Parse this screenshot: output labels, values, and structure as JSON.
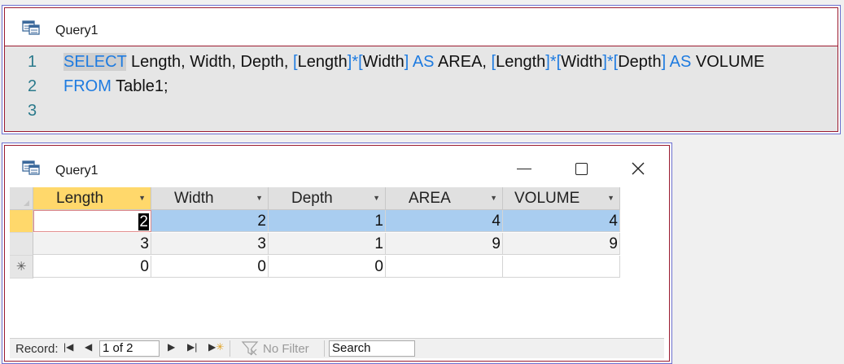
{
  "sql_window": {
    "title": "Query1",
    "lines": [
      {
        "number": "1",
        "segments": {
          "kw_select": "SELECT",
          "t1": " Length, Width, Depth, ",
          "b1": "[",
          "t2": "Length",
          "b2": "]",
          "op1": "*",
          "b3": "[",
          "t3": "Width",
          "b4": "]",
          "t4": " ",
          "kw_as1": "AS",
          "t5": " AREA, ",
          "b5": "[",
          "t6": "Length",
          "b6": "]",
          "op2": "*",
          "b7": "[",
          "t7": "Width",
          "b8": "]",
          "op3": "*",
          "b9": "[",
          "t8": "Depth",
          "b10": "]",
          "t9": " ",
          "kw_as2": "AS",
          "t10": " VOLUME"
        }
      },
      {
        "number": "2",
        "segments": {
          "kw_from": "FROM",
          "t1": " Table1;"
        }
      },
      {
        "number": "3"
      }
    ]
  },
  "datasheet_window": {
    "title": "Query1",
    "columns": [
      "Length",
      "Width",
      "Depth",
      "AREA",
      "VOLUME"
    ],
    "rows": [
      [
        "2",
        "2",
        "1",
        "4",
        "4"
      ],
      [
        "3",
        "3",
        "1",
        "9",
        "9"
      ],
      [
        "0",
        "0",
        "0",
        "",
        ""
      ]
    ],
    "new_row_marker": "✳",
    "navigation": {
      "record_label": "Record:",
      "position": "1 of 2",
      "filter_label": "No Filter",
      "search_placeholder": "Search"
    }
  }
}
